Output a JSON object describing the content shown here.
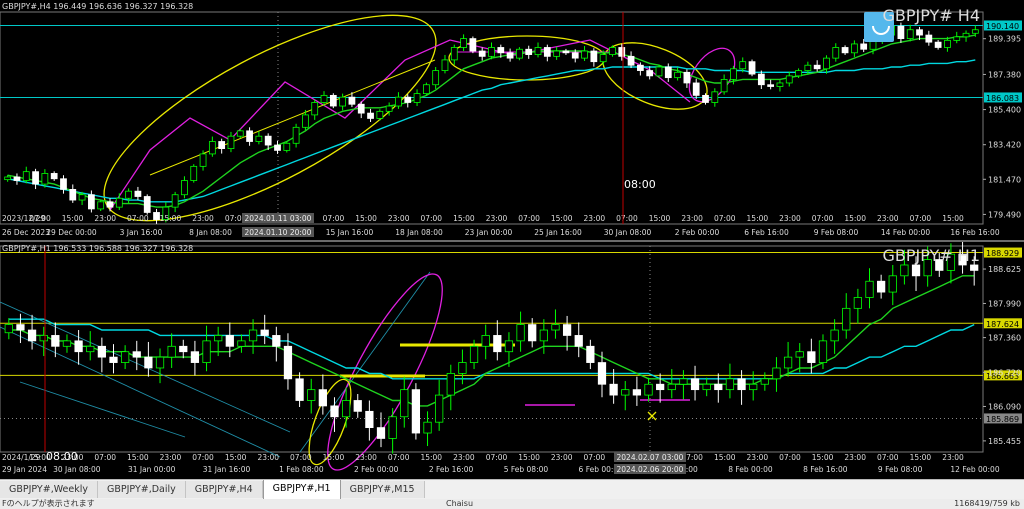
{
  "tabs": [
    {
      "label": "GBPJPY#,Weekly",
      "active": false
    },
    {
      "label": "GBPJPY#,Daily",
      "active": false
    },
    {
      "label": "GBPJPY#,H4",
      "active": false
    },
    {
      "label": "GBPJPY#,H1",
      "active": true
    },
    {
      "label": "GBPJPY#,M15",
      "active": false
    }
  ],
  "status": {
    "left": "Fのヘルプが表示されます",
    "mid": "Chaisu",
    "right": "1168419/759 kb"
  },
  "colors": {
    "background": "#000000",
    "bull": "#00ff00",
    "bear": "#ffffff",
    "ma_fast": "#1fd31f",
    "ma_slow": "#00d8e0",
    "hline_cyan": "#00c8c8",
    "hline_yellow": "#d8d800",
    "drawing_yellow": "#e8e800",
    "drawing_magenta": "#e020e0",
    "crosshair": "#c00000"
  },
  "chart_data": [
    {
      "type": "candlestick",
      "title": "GBPJPY#,H4  196.449 196.636 196.327 196.328",
      "symbol_label": "GBPJPY# H4",
      "y_ticks": [
        "190.140",
        "189.395",
        "187.380",
        "186.083",
        "185.400",
        "183.420",
        "181.470",
        "179.490"
      ],
      "y_tick_values": [
        190.14,
        189.395,
        187.38,
        186.083,
        185.4,
        183.42,
        181.47,
        179.49
      ],
      "ylim": [
        178.95,
        190.9
      ],
      "x_ticks": [
        "26 Dec 2023",
        "29 Dec 00:00",
        "3 Jan 16:00",
        "8 Jan 08:00",
        "10 Jan 20:00",
        "15 Jan 16:00",
        "18 Jan 08:00",
        "23 Jan 00:00",
        "25 Jan 16:00",
        "30 Jan 08:00",
        "2 Feb 00:00",
        "6 Feb 16:00",
        "9 Feb 08:00",
        "14 Feb 00:00",
        "16 Feb 16:00"
      ],
      "hour_labels": [
        "07:00",
        "15:00",
        "23:00",
        "07:00",
        "15:00",
        "23:00",
        "07:00",
        "15:00",
        "23:00",
        "07:00",
        "15:00",
        "23:00",
        "07:00",
        "15:00",
        "23:00",
        "07:00",
        "15:00",
        "23:00",
        "07:00",
        "15:00",
        "23:00",
        "07:00",
        "15:00",
        "23:00",
        "07:00",
        "15:00",
        "23:00",
        "07:00",
        "15:00"
      ],
      "crosshair_labels": [
        "2023/12/29",
        "2024.01.11 03:00",
        "2024.01.10 20:00"
      ],
      "time_marker": "08:00",
      "price_levels": [
        {
          "label": "190.140",
          "value": 190.14,
          "color": "#00c8c8"
        },
        {
          "label": "186.083",
          "value": 186.083,
          "color": "#00c8c8"
        }
      ],
      "closes": [
        181.6,
        181.4,
        181.9,
        181.2,
        181.8,
        181.5,
        180.9,
        180.3,
        180.6,
        179.8,
        180.2,
        179.9,
        180.4,
        180.8,
        180.5,
        179.6,
        179.2,
        179.9,
        180.6,
        181.4,
        182.2,
        182.9,
        183.6,
        183.2,
        183.9,
        184.2,
        183.6,
        183.9,
        183.4,
        183.1,
        183.5,
        184.4,
        185.1,
        185.8,
        186.2,
        185.6,
        186.1,
        185.7,
        185.2,
        184.9,
        185.3,
        185.6,
        186.1,
        185.8,
        186.3,
        186.8,
        187.6,
        188.2,
        188.9,
        189.4,
        188.7,
        188.4,
        188.9,
        188.6,
        188.3,
        188.8,
        188.5,
        188.9,
        188.4,
        188.7,
        188.6,
        188.3,
        188.7,
        188.1,
        188.5,
        188.9,
        188.4,
        187.9,
        187.6,
        187.3,
        187.8,
        187.2,
        187.5,
        186.9,
        186.2,
        185.8,
        186.4,
        187.1,
        187.7,
        188.1,
        187.4,
        186.8,
        186.7,
        186.9,
        187.3,
        187.6,
        187.9,
        187.7,
        188.3,
        188.9,
        188.6,
        189.1,
        188.8,
        189.3,
        189.6,
        190.1,
        189.4,
        189.9,
        189.6,
        189.2,
        188.9,
        189.3,
        189.5,
        189.7,
        189.9
      ],
      "ma_fast": [
        181.7,
        181.6,
        181.5,
        181.4,
        181.3,
        181.2,
        181.0,
        180.8,
        180.6,
        180.4,
        180.3,
        180.2,
        180.1,
        180.1,
        180.1,
        180.0,
        179.9,
        179.9,
        180.0,
        180.2,
        180.5,
        180.8,
        181.2,
        181.6,
        182.0,
        182.4,
        182.7,
        183.0,
        183.2,
        183.4,
        183.6,
        183.9,
        184.2,
        184.6,
        184.9,
        185.1,
        185.3,
        185.4,
        185.5,
        185.5,
        185.5,
        185.6,
        185.7,
        185.8,
        186.0,
        186.2,
        186.5,
        186.9,
        187.3,
        187.7,
        187.9,
        188.1,
        188.3,
        188.4,
        188.5,
        188.6,
        188.6,
        188.7,
        188.7,
        188.7,
        188.7,
        188.7,
        188.7,
        188.6,
        188.6,
        188.6,
        188.5,
        188.4,
        188.2,
        188.0,
        187.9,
        187.7,
        187.6,
        187.4,
        187.2,
        187.0,
        186.9,
        186.9,
        187.0,
        187.1,
        187.1,
        187.1,
        187.1,
        187.1,
        187.2,
        187.3,
        187.4,
        187.5,
        187.7,
        187.9,
        188.1,
        188.3,
        188.5,
        188.7,
        188.9,
        189.1,
        189.2,
        189.3,
        189.4,
        189.4,
        189.4,
        189.4,
        189.5,
        189.5,
        189.6
      ],
      "ma_slow": [
        181.5,
        181.4,
        181.3,
        181.2,
        181.1,
        181.0,
        180.9,
        180.8,
        180.7,
        180.6,
        180.5,
        180.4,
        180.4,
        180.3,
        180.3,
        180.2,
        180.2,
        180.2,
        180.2,
        180.3,
        180.4,
        180.5,
        180.7,
        180.9,
        181.1,
        181.3,
        181.5,
        181.7,
        181.9,
        182.1,
        182.3,
        182.5,
        182.7,
        182.9,
        183.1,
        183.3,
        183.5,
        183.7,
        183.9,
        184.1,
        184.3,
        184.5,
        184.7,
        184.9,
        185.1,
        185.3,
        185.5,
        185.7,
        185.9,
        186.1,
        186.3,
        186.5,
        186.6,
        186.8,
        186.9,
        187.0,
        187.1,
        187.2,
        187.3,
        187.4,
        187.5,
        187.6,
        187.6,
        187.7,
        187.7,
        187.8,
        187.8,
        187.8,
        187.8,
        187.8,
        187.8,
        187.8,
        187.8,
        187.7,
        187.7,
        187.7,
        187.6,
        187.6,
        187.6,
        187.6,
        187.5,
        187.5,
        187.5,
        187.5,
        187.5,
        187.5,
        187.5,
        187.5,
        187.5,
        187.6,
        187.6,
        187.6,
        187.7,
        187.7,
        187.7,
        187.8,
        187.8,
        187.9,
        187.9,
        188.0,
        188.0,
        188.0,
        188.1,
        188.1,
        188.2
      ]
    },
    {
      "type": "candlestick",
      "title": "GBPJPY#,H1  196.533 196.588 196.327 196.328",
      "symbol_label": "GBPJPY# H1",
      "y_ticks": [
        "188.929",
        "188.625",
        "187.990",
        "187.624",
        "187.360",
        "186.720",
        "186.663",
        "186.090",
        "185.869",
        "185.455"
      ],
      "y_tick_values": [
        188.929,
        188.625,
        187.99,
        187.624,
        187.36,
        186.72,
        186.663,
        186.09,
        185.869,
        185.455
      ],
      "ylim": [
        185.25,
        189.05
      ],
      "x_ticks": [
        "29 Jan 2024",
        "30 Jan 08:00",
        "31 Jan 00:00",
        "31 Jan 16:00",
        "1 Feb 08:00",
        "2 Feb 00:00",
        "2 Feb 16:00",
        "5 Feb 08:00",
        "6 Feb 00:00",
        "7 Feb 08:00",
        "8 Feb 00:00",
        "8 Feb 16:00",
        "9 Feb 08:00",
        "12 Feb 00:00"
      ],
      "hour_labels": [
        "15:00",
        "23:00",
        "07:00",
        "15:00",
        "23:00",
        "07:00",
        "15:00",
        "23:00",
        "07:00",
        "15:00",
        "23:00",
        "07:00",
        "15:00",
        "23:00",
        "07:00",
        "15:00",
        "23:00",
        "07:00",
        "15:00",
        "23:00",
        "07:00",
        "15:00",
        "23:00",
        "07:00",
        "15:00",
        "23:00",
        "07:00",
        "15:00",
        "23:00"
      ],
      "crosshair_labels": [
        "2024/1/29",
        "2024.02.07 03:00",
        "2024.02.06 20:00"
      ],
      "time_marker": "08:00",
      "price_levels": [
        {
          "label": "188.929",
          "value": 188.929,
          "color": "#d8d800"
        },
        {
          "label": "187.624",
          "value": 187.624,
          "color": "#d8d800"
        },
        {
          "label": "186.663",
          "value": 186.663,
          "color": "#d8d800"
        },
        {
          "label": "185.869",
          "value": 185.869,
          "color": "#888888"
        }
      ],
      "closes": [
        187.6,
        187.5,
        187.3,
        187.4,
        187.2,
        187.3,
        187.1,
        187.2,
        187.0,
        186.9,
        187.1,
        187.0,
        186.8,
        187.0,
        187.2,
        187.1,
        186.9,
        187.3,
        187.4,
        187.2,
        187.3,
        187.5,
        187.4,
        187.2,
        186.6,
        186.2,
        186.4,
        186.1,
        185.9,
        186.2,
        186.0,
        185.7,
        185.5,
        185.9,
        186.4,
        185.6,
        185.8,
        186.3,
        186.7,
        186.9,
        187.2,
        187.4,
        187.1,
        187.3,
        187.6,
        187.3,
        187.5,
        187.6,
        187.4,
        187.2,
        186.9,
        186.5,
        186.3,
        186.4,
        186.3,
        186.5,
        186.4,
        186.5,
        186.6,
        186.4,
        186.5,
        186.4,
        186.6,
        186.4,
        186.5,
        186.6,
        186.8,
        187.0,
        187.1,
        186.9,
        187.3,
        187.5,
        187.9,
        188.1,
        188.4,
        188.2,
        188.5,
        188.7,
        188.5,
        188.8,
        188.6,
        188.9,
        188.7,
        188.6
      ],
      "ma_fast": [
        187.5,
        187.5,
        187.4,
        187.4,
        187.3,
        187.3,
        187.2,
        187.2,
        187.1,
        187.1,
        187.1,
        187.0,
        187.0,
        187.0,
        187.0,
        187.0,
        187.0,
        187.1,
        187.1,
        187.1,
        187.2,
        187.2,
        187.2,
        187.2,
        187.1,
        187.0,
        186.9,
        186.8,
        186.7,
        186.6,
        186.5,
        186.4,
        186.3,
        186.2,
        186.2,
        186.1,
        186.1,
        186.2,
        186.3,
        186.4,
        186.5,
        186.7,
        186.8,
        186.9,
        187.0,
        187.1,
        187.2,
        187.2,
        187.2,
        187.2,
        187.1,
        187.0,
        186.9,
        186.8,
        186.7,
        186.6,
        186.6,
        186.5,
        186.5,
        186.5,
        186.5,
        186.5,
        186.5,
        186.5,
        186.5,
        186.6,
        186.6,
        186.7,
        186.8,
        186.8,
        186.9,
        187.0,
        187.2,
        187.4,
        187.6,
        187.7,
        187.9,
        188.0,
        188.1,
        188.2,
        188.3,
        188.4,
        188.5,
        188.5
      ],
      "ma_slow": [
        187.7,
        187.7,
        187.7,
        187.7,
        187.6,
        187.6,
        187.6,
        187.6,
        187.5,
        187.5,
        187.5,
        187.5,
        187.5,
        187.4,
        187.4,
        187.4,
        187.4,
        187.4,
        187.4,
        187.4,
        187.4,
        187.4,
        187.4,
        187.3,
        187.3,
        187.2,
        187.1,
        187.0,
        186.9,
        186.8,
        186.8,
        186.7,
        186.7,
        186.6,
        186.6,
        186.6,
        186.6,
        186.6,
        186.6,
        186.6,
        186.6,
        186.7,
        186.7,
        186.7,
        186.7,
        186.7,
        186.7,
        186.7,
        186.7,
        186.7,
        186.7,
        186.7,
        186.7,
        186.7,
        186.7,
        186.7,
        186.6,
        186.6,
        186.6,
        186.6,
        186.6,
        186.6,
        186.6,
        186.6,
        186.6,
        186.6,
        186.6,
        186.7,
        186.7,
        186.7,
        186.7,
        186.8,
        186.8,
        186.9,
        187.0,
        187.0,
        187.1,
        187.2,
        187.2,
        187.3,
        187.4,
        187.5,
        187.5,
        187.6
      ]
    }
  ]
}
